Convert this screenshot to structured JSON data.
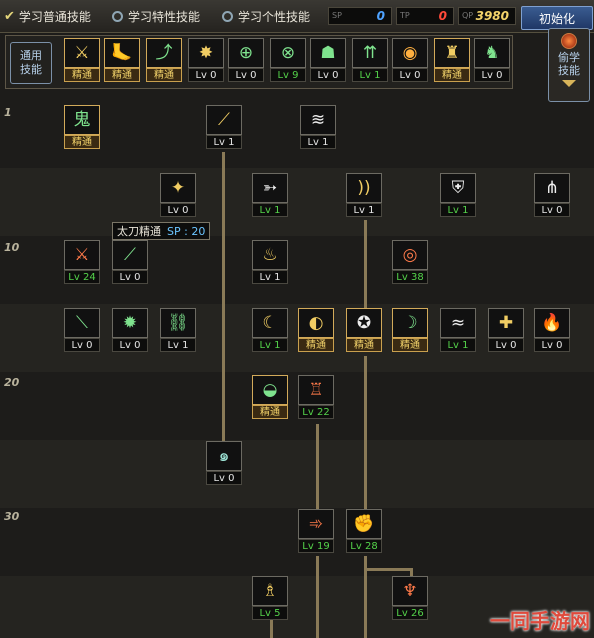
{
  "tabs": [
    {
      "label": "学习普通技能",
      "active": true
    },
    {
      "label": "学习特性技能",
      "active": false
    },
    {
      "label": "学习个性技能",
      "active": false
    }
  ],
  "sp_boxes": [
    {
      "tag": "SP",
      "value": "0",
      "color": "#4fa3ff"
    },
    {
      "tag": "TP",
      "value": "0",
      "color": "#ff4a3a"
    },
    {
      "tag": "QP",
      "value": "3980",
      "color": "#f3d36a"
    }
  ],
  "reset_label": "初始化",
  "quickbar": {
    "label_line1": "通用",
    "label_line2": "技能",
    "side_line1": "偷学",
    "side_line2": "技能",
    "skills": [
      {
        "level": "精通",
        "icon": "zanbato-icon",
        "glyph": "⚔",
        "color": "gold",
        "master": true
      },
      {
        "level": "精通",
        "icon": "kick-icon",
        "glyph": "🦶",
        "color": "gold",
        "master": true
      },
      {
        "level": "精通",
        "icon": "leap-icon",
        "glyph": "⤴",
        "color": "green",
        "master": true
      },
      {
        "level": "Lv 0",
        "icon": "wings-icon",
        "glyph": "✸",
        "color": "gold",
        "master": false
      },
      {
        "level": "Lv 0",
        "icon": "target-icon",
        "glyph": "⊕",
        "color": "green",
        "master": false
      },
      {
        "level": "Lv 9",
        "icon": "crosshair-icon",
        "glyph": "⊗",
        "color": "green",
        "master": false,
        "green": true
      },
      {
        "level": "Lv 0",
        "icon": "guard-icon",
        "glyph": "☗",
        "color": "green",
        "master": false
      },
      {
        "level": "Lv 1",
        "icon": "rise-icon",
        "glyph": "⇈",
        "color": "green",
        "master": false,
        "green": true
      },
      {
        "level": "Lv 0",
        "icon": "eye-icon",
        "glyph": "◉",
        "color": "orange",
        "master": false
      },
      {
        "level": "精通",
        "icon": "armor-icon",
        "glyph": "♜",
        "color": "gold",
        "master": true
      },
      {
        "level": "Lv 0",
        "icon": "runner-icon",
        "glyph": "♞",
        "color": "green",
        "master": false
      }
    ]
  },
  "level_marks": [
    "1",
    "10",
    "20",
    "30"
  ],
  "tooltip": {
    "name": "太刀精通",
    "sp": "SP : 20"
  },
  "tree": [
    {
      "level": "精通",
      "icon": "ghost-sword-icon",
      "glyph": "鬼",
      "color": "green",
      "master": true
    },
    {
      "level": "Lv 1",
      "icon": "slash-icon",
      "glyph": "⟋",
      "color": "gold"
    },
    {
      "level": "Lv 1",
      "icon": "claw-icon",
      "glyph": "≋",
      "color": "white"
    },
    {
      "level": "Lv 0",
      "icon": "burst-icon",
      "glyph": "✦",
      "color": "gold"
    },
    {
      "level": "Lv 1",
      "icon": "arrow-icon",
      "glyph": "➳",
      "color": "white",
      "green": true
    },
    {
      "level": "Lv 1",
      "icon": "wave-icon",
      "glyph": "))",
      "color": "gold"
    },
    {
      "level": "Lv 1",
      "icon": "shield-icon",
      "glyph": "⛨",
      "color": "white",
      "green": true
    },
    {
      "level": "Lv 0",
      "icon": "spread-icon",
      "glyph": "⋔",
      "color": "white"
    },
    {
      "level": "Lv 24",
      "icon": "blade-icon",
      "glyph": "⚔",
      "color": "red",
      "green": true
    },
    {
      "level": "Lv 0",
      "icon": "sword-icon",
      "glyph": "⟋",
      "color": "green"
    },
    {
      "level": "Lv 1",
      "icon": "flame-icon",
      "glyph": "♨",
      "color": "gold"
    },
    {
      "level": "Lv 38",
      "icon": "fire-ring-icon",
      "glyph": "◎",
      "color": "red",
      "green": true
    },
    {
      "level": "Lv 0",
      "icon": "sword2-icon",
      "glyph": "⟍",
      "color": "green"
    },
    {
      "level": "Lv 0",
      "icon": "star-burst-icon",
      "glyph": "✹",
      "color": "green"
    },
    {
      "level": "Lv 1",
      "icon": "chain-icon",
      "glyph": "⛓",
      "color": "green"
    },
    {
      "level": "Lv 1",
      "icon": "crescent-icon",
      "glyph": "☾",
      "color": "gold",
      "green": true
    },
    {
      "level": "精通",
      "icon": "moon-shield-icon",
      "glyph": "◐",
      "color": "gold",
      "master": true
    },
    {
      "level": "精通",
      "icon": "pentagram-icon",
      "glyph": "✪",
      "color": "white",
      "master": true
    },
    {
      "level": "精通",
      "icon": "moon-icon",
      "glyph": "☽",
      "color": "green",
      "master": true
    },
    {
      "level": "Lv 1",
      "icon": "tornado-icon",
      "glyph": "≈",
      "color": "white",
      "green": true
    },
    {
      "level": "Lv 0",
      "icon": "cross-icon",
      "glyph": "✚",
      "color": "gold"
    },
    {
      "level": "Lv 0",
      "icon": "fire-blade-icon",
      "glyph": "🔥",
      "color": "gold"
    },
    {
      "level": "精通",
      "icon": "half-moon-icon",
      "glyph": "◒",
      "color": "green",
      "master": true
    },
    {
      "level": "Lv 22",
      "icon": "tower-icon",
      "glyph": "♖",
      "color": "red",
      "green": true
    },
    {
      "level": "Lv 0",
      "icon": "whirl-icon",
      "glyph": "๑",
      "color": "teal"
    },
    {
      "level": "Lv 19",
      "icon": "dash-icon",
      "glyph": "➾",
      "color": "red",
      "green": true
    },
    {
      "level": "Lv 28",
      "icon": "fist-icon",
      "glyph": "✊",
      "color": "red",
      "green": true
    },
    {
      "level": "Lv 5",
      "icon": "pillar-icon",
      "glyph": "♗",
      "color": "gold",
      "green": true
    },
    {
      "level": "Lv 26",
      "icon": "dragon-icon",
      "glyph": "♆",
      "color": "red",
      "green": true
    }
  ],
  "watermark": "一同手游网"
}
